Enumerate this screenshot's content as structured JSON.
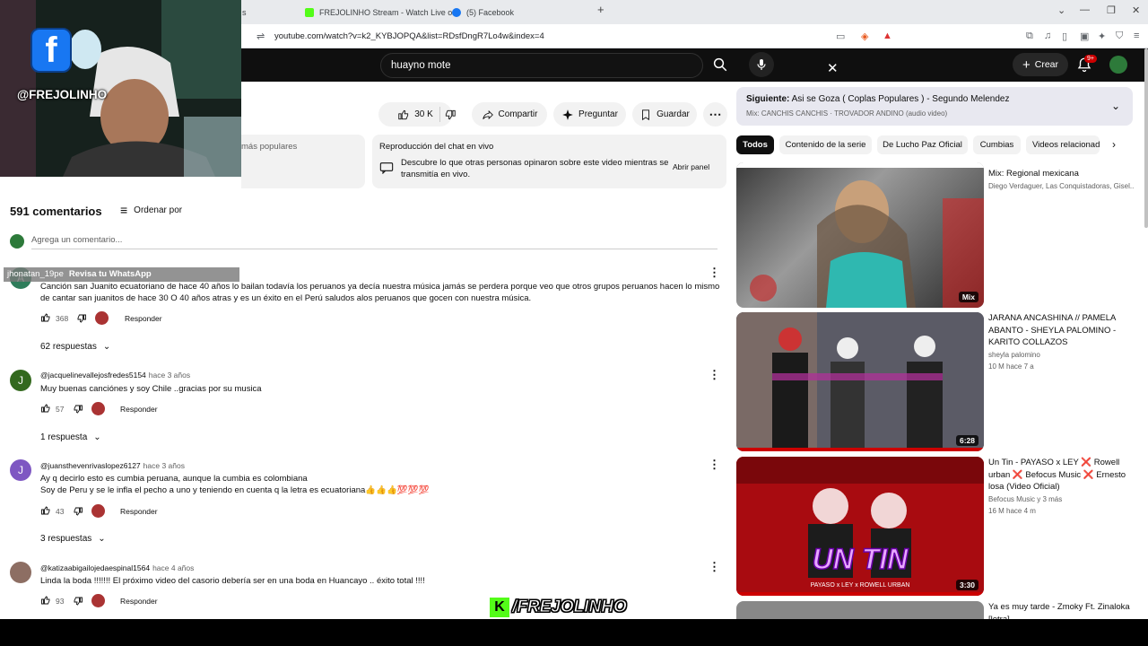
{
  "browser": {
    "tabs": [
      {
        "label": "s"
      },
      {
        "label": "FREJOLINHO Stream - Watch Live on"
      },
      {
        "label": "(5) Facebook"
      }
    ],
    "url": "youtube.com/watch?v=k2_KYBJOPQA&list=RDsfDngR7Lo4w&index=4"
  },
  "youtube": {
    "search_value": "huayno mote",
    "create_label": "Crear",
    "notif_count": "9+",
    "actions": {
      "likes": "30 K",
      "share": "Compartir",
      "ask": "Preguntar",
      "save": "Guardar"
    },
    "left_card_text": "más populares",
    "chat": {
      "title": "Reproducción del chat en vivo",
      "description": "Descubre lo que otras personas opinaron sobre este video mientras se transmitía en vivo.",
      "open": "Abrir panel"
    },
    "comments_header": {
      "count": "591 comentarios",
      "sort": "Ordenar por",
      "placeholder": "Agrega un comentario..."
    },
    "overlay_tag": {
      "user": "jhonatan_19pe",
      "text": "Revisa tu WhatsApp"
    },
    "comments": [
      {
        "avatar": "A",
        "avatar_color": "#2f7d5b",
        "user": "",
        "time": "",
        "text": "Canción san Juanito ecuatoriano de hace 40 años lo bailan todavía los peruanos ya decía nuestra música jamás se perdera porque veo que otros grupos peruanos hacen lo mismo de cantar san juanitos de hace 30 O 40  años atras y es un éxito en el Perú saludos alos peruanos que gocen con nuestra música.",
        "likes": "368",
        "reply": "Responder",
        "replies": "62 respuestas"
      },
      {
        "avatar": "J",
        "avatar_color": "#33691e",
        "user": "@jacquelinevallejosfredes5154",
        "time": "hace 3 años",
        "text": "Muy buenas canciónes y soy Chile ..gracias por su  musica",
        "likes": "57",
        "reply": "Responder",
        "replies": "1 respuesta"
      },
      {
        "avatar": "J",
        "avatar_color": "#7e57c2",
        "user": "@juansthevenrivaslopez6127",
        "time": "hace 3 años",
        "text": "Ay q decirlo esto es cumbia peruana, aunque la cumbia es colombiana\nSoy de Peru y se le infla el pecho a uno y teniendo en cuenta q la letra es ecuatoriana👍👍👍💯💯💯",
        "likes": "43",
        "reply": "Responder",
        "replies": "3 respuestas"
      },
      {
        "avatar": "",
        "avatar_color": "#8d6e63",
        "user": "@katizaabigailojedaespinal1564",
        "time": "hace 4 años",
        "text": "Linda la boda !!!!!!! El próximo video del casorio debería ser en una boda en Huancayo .. éxito total !!!!",
        "likes": "93",
        "reply": "Responder",
        "replies": ""
      }
    ],
    "next": {
      "label": "Siguiente:",
      "title": "Asi se Goza ( Coplas Populares ) - Segundo Melendez",
      "subtitle": "Mix: CANCHIS CANCHIS · TROVADOR ANDINO (audio video)"
    },
    "chips": [
      "Todos",
      "Contenido de la serie",
      "De Lucho Paz Oficial",
      "Cumbias",
      "Videos relacionados"
    ],
    "videos": [
      {
        "title": "Mix: Regional mexicana",
        "channel": "Diego Verdaguer, Las Conquistadoras, Gisel...",
        "meta": "",
        "duration": "Mix"
      },
      {
        "title": "JARANA ANCASHINA // PAMELA ABANTO - SHEYLA PALOMINO - KARITO COLLAZOS",
        "channel": "sheyla palomino",
        "meta": "10 M   hace 7 a",
        "duration": "6:28"
      },
      {
        "title": "Un Tin - PAYASO x LEY ❌ Rowell urban ❌ Befocus Music ❌ Ernesto losa (Video Oficial)",
        "channel": "Befocus Music y 3 más",
        "meta": "16 M   hace 4 m",
        "duration": "3:30"
      },
      {
        "title": "Ya es muy tarde - Zmoky Ft. Zinaloka [letra]",
        "channel": "",
        "meta": "",
        "duration": ""
      }
    ]
  },
  "stream": {
    "handle": "@FREJOLINHO",
    "brand": "/FREJOLINHO",
    "brand_k": "K",
    "fb_letter": "f",
    "thumb_text_3": "UN TIN",
    "thumb_caption_3": "PAYASO x LEY x ROWELL URBAN"
  }
}
